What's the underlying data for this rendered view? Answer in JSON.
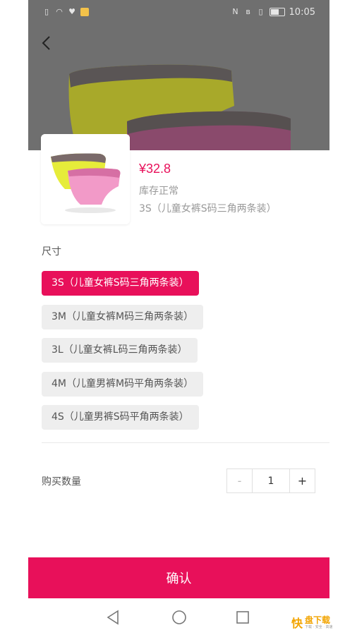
{
  "status_bar": {
    "time": "10:05"
  },
  "product": {
    "price": "¥32.8",
    "stock_status": "库存正常",
    "selected_spec": "3S（儿童女裤S码三角两条装）"
  },
  "spec": {
    "label": "尺寸",
    "options": [
      {
        "label": "3S（儿童女裤S码三角两条装）",
        "selected": true
      },
      {
        "label": "3M（儿童女裤M码三角两条装）",
        "selected": false
      },
      {
        "label": "3L（儿童女裤L码三角两条装）",
        "selected": false
      },
      {
        "label": "4M（儿童男裤M码平角两条装）",
        "selected": false
      },
      {
        "label": "4S（儿童男裤S码平角两条装）",
        "selected": false
      }
    ]
  },
  "quantity": {
    "label": "购买数量",
    "minus": "-",
    "value": "1",
    "plus": "+"
  },
  "confirm_label": "确认",
  "watermark": {
    "glyph": "快",
    "main": "盘下载",
    "sub": "下载 · 安全 · 高速"
  },
  "colors": {
    "accent": "#e8105a",
    "option_bg": "#eeeeee",
    "hero_overlay": "#6e6e6e"
  }
}
